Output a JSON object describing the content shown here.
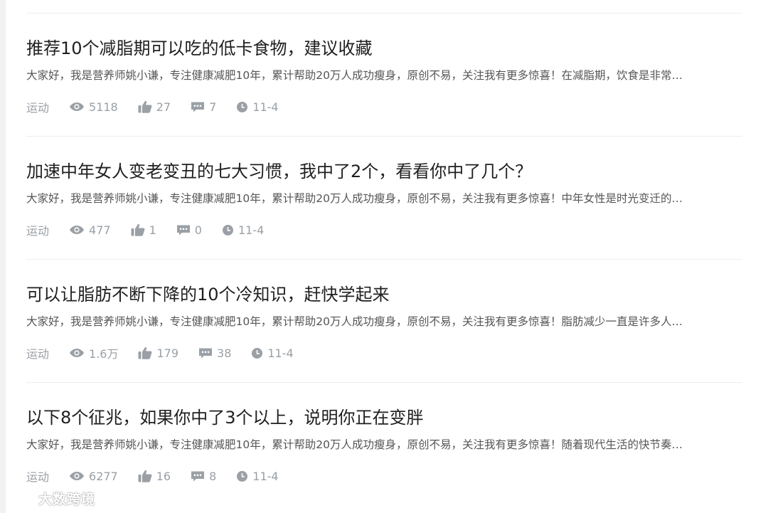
{
  "feed": {
    "items": [
      {
        "title": "推荐10个减脂期可以吃的低卡食物，建议收藏",
        "summary": "大家好，我是营养师姚小谦，专注健康减肥10年，累计帮助20万人成功瘦身，原创不易，关注我有更多惊喜！在减脂期，饮食是非常…",
        "category": "运动",
        "views": "5118",
        "likes": "27",
        "comments": "7",
        "date": "11-4"
      },
      {
        "title": "加速中年女人变老变丑的七大习惯，我中了2个，看看你中了几个？",
        "summary": "大家好，我是营养师姚小谦，专注健康减肥10年，累计帮助20万人成功瘦身，原创不易，关注我有更多惊喜！中年女性是时光变迁的…",
        "category": "运动",
        "views": "477",
        "likes": "1",
        "comments": "0",
        "date": "11-4"
      },
      {
        "title": "可以让脂肪不断下降的10个冷知识，赶快学起来",
        "summary": "大家好，我是营养师姚小谦，专注健康减肥10年，累计帮助20万人成功瘦身，原创不易，关注我有更多惊喜！脂肪减少一直是许多人…",
        "category": "运动",
        "views": "1.6万",
        "likes": "179",
        "comments": "38",
        "date": "11-4"
      },
      {
        "title": "以下8个征兆，如果你中了3个以上，说明你正在变胖",
        "summary": "大家好，我是营养师姚小谦，专注健康减肥10年，累计帮助20万人成功瘦身，原创不易，关注我有更多惊喜！随着现代生活的快节奏…",
        "category": "运动",
        "views": "6277",
        "likes": "16",
        "comments": "8",
        "date": "11-4"
      }
    ]
  },
  "icons": {
    "views": "eye-icon",
    "likes": "thumbs-up-icon",
    "comments": "comment-icon",
    "date": "clock-icon"
  },
  "colors": {
    "title": "#1f1f1f",
    "summary": "#555555",
    "meta": "#9aa0a6",
    "divider": "#eeeeee"
  },
  "watermark": {
    "text": "大数跨境"
  }
}
